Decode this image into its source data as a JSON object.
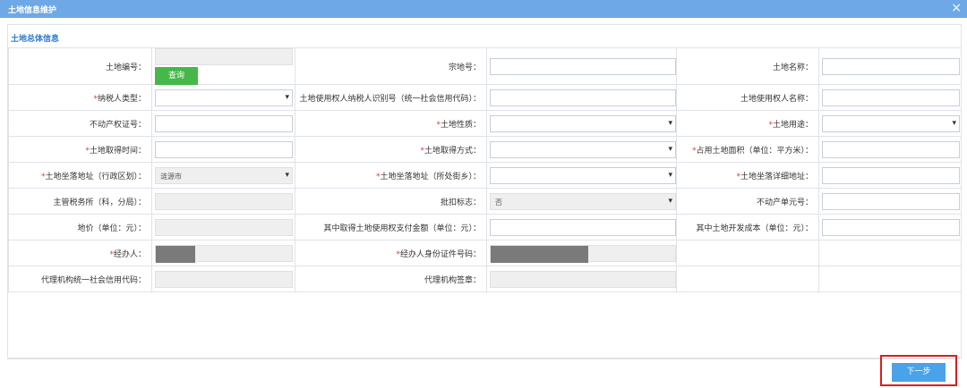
{
  "window": {
    "title": "土地信息维护",
    "close_glyph": "×"
  },
  "section": {
    "title": "土地总体信息"
  },
  "buttons": {
    "query": "查询",
    "next": "下一步"
  },
  "fields": {
    "land_no": {
      "label": "土地编号：",
      "value": ""
    },
    "parcel_no": {
      "label": "宗地号：",
      "value": ""
    },
    "land_name": {
      "label": "土地名称：",
      "value": ""
    },
    "taxpayer_type": {
      "label": "纳税人类型：",
      "value": ""
    },
    "user_taxpayer_id": {
      "label": "土地使用权人纳税人识别号（统一社会信用代码）：",
      "value": ""
    },
    "user_name": {
      "label": "土地使用权人名称：",
      "value": ""
    },
    "property_cert_no": {
      "label": "不动产权证号：",
      "value": ""
    },
    "land_nature": {
      "label": "土地性质：",
      "value": ""
    },
    "land_use": {
      "label": "土地用途：",
      "value": ""
    },
    "acquire_time": {
      "label": "土地取得时间：",
      "value": ""
    },
    "acquire_method": {
      "label": "土地取得方式：",
      "value": ""
    },
    "occupied_area": {
      "label": "占用土地面积（单位：平方米）：",
      "value": ""
    },
    "location_district": {
      "label": "土地坐落地址（行政区划）：",
      "value": "涟源市"
    },
    "location_street": {
      "label": "土地坐落地址（所处街乡）：",
      "value": ""
    },
    "location_detail": {
      "label": "土地坐落详细地址：",
      "value": ""
    },
    "tax_office": {
      "label": "主管税务所（科，分局）：",
      "value": ""
    },
    "approval_flag": {
      "label": "批扣标志：",
      "value": "否"
    },
    "property_unit_no": {
      "label": "不动产单元号：",
      "value": ""
    },
    "land_price": {
      "label": "地价（单位：元）：",
      "value": ""
    },
    "use_right_fee": {
      "label": "其中取得土地使用权支付金额（单位：元）：",
      "value": ""
    },
    "dev_cost": {
      "label": "其中土地开发成本（单位：元）：",
      "value": ""
    },
    "handler": {
      "label": "经办人：",
      "value": ""
    },
    "handler_id": {
      "label": "经办人身份证件号码：",
      "value": ""
    },
    "agency_credit_code": {
      "label": "代理机构统一社会信用代码：",
      "value": ""
    },
    "agency_seal": {
      "label": "代理机构签章：",
      "value": ""
    }
  },
  "required_mark": "*"
}
